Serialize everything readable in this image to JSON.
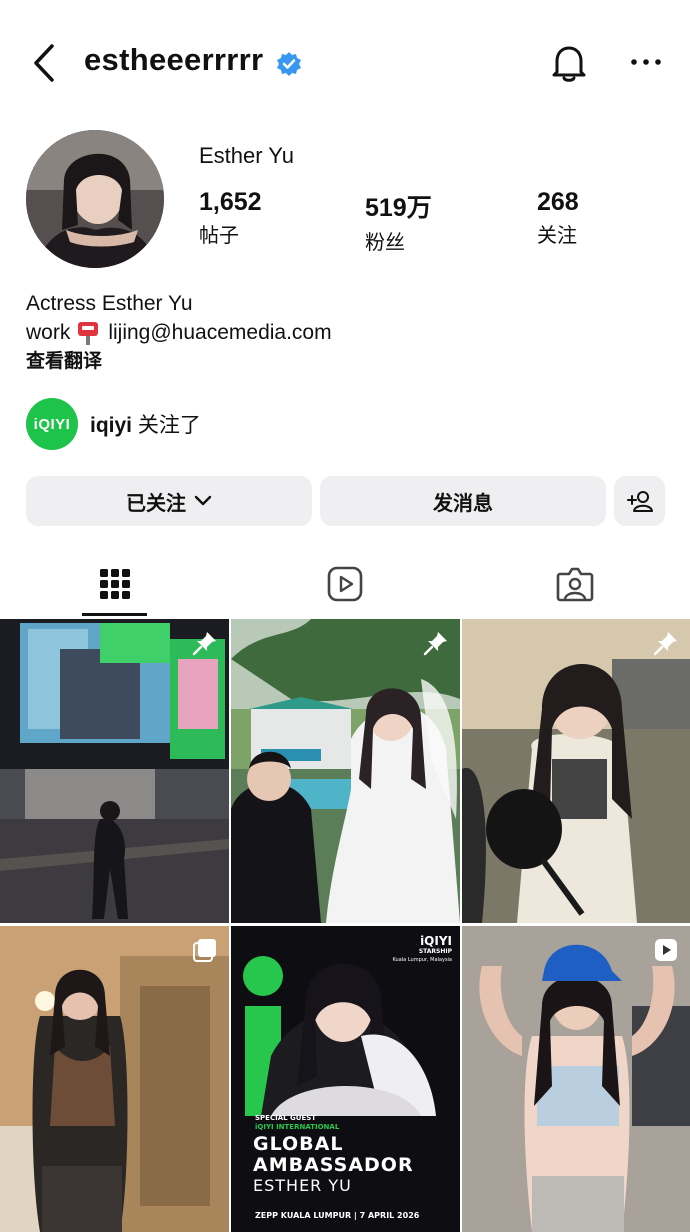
{
  "header": {
    "username": "estheeerrrrr"
  },
  "profile": {
    "display_name": "Esther Yu",
    "stats": [
      {
        "value": "1,652",
        "label": "帖子"
      },
      {
        "value": "519万",
        "label": "粉丝"
      },
      {
        "value": "268",
        "label": "关注"
      }
    ],
    "bio_line1": "Actress Esther Yu",
    "bio_line2_prefix": "work",
    "bio_line2_email": "lijing@huacemedia.com",
    "translate_label": "查看翻译"
  },
  "followed_by": {
    "badge_text": "iQIYI",
    "account": "iqiyi",
    "suffix": "关注了"
  },
  "actions": {
    "following_label": "已关注",
    "message_label": "发消息"
  },
  "grid": {
    "posts": [
      {
        "type": "pinned",
        "icon": "pin-icon"
      },
      {
        "type": "pinned",
        "icon": "pin-icon"
      },
      {
        "type": "pinned",
        "icon": "pin-icon"
      },
      {
        "type": "carousel",
        "icon": "carousel-icon"
      },
      {
        "type": "image",
        "icon": "",
        "overlay": {
          "brand": "iQIYI",
          "brand_sub": "STARSHIP",
          "location": "Kuala Lumpur, Malaysia",
          "special": "SPECIAL GUEST",
          "special_sub": "iQIYI INTERNATIONAL",
          "headline1": "GLOBAL",
          "headline2": "AMBASSADOR",
          "name": "ESTHER YU",
          "footer": "ZEPP KUALA LUMPUR | 7 APRIL 2026"
        }
      },
      {
        "type": "reel",
        "icon": "reel-icon"
      }
    ]
  },
  "colors": {
    "verified": "#3897f0",
    "iqiyi_green": "#1ec44a",
    "button_bg": "#efeff1",
    "text": "#111111"
  }
}
